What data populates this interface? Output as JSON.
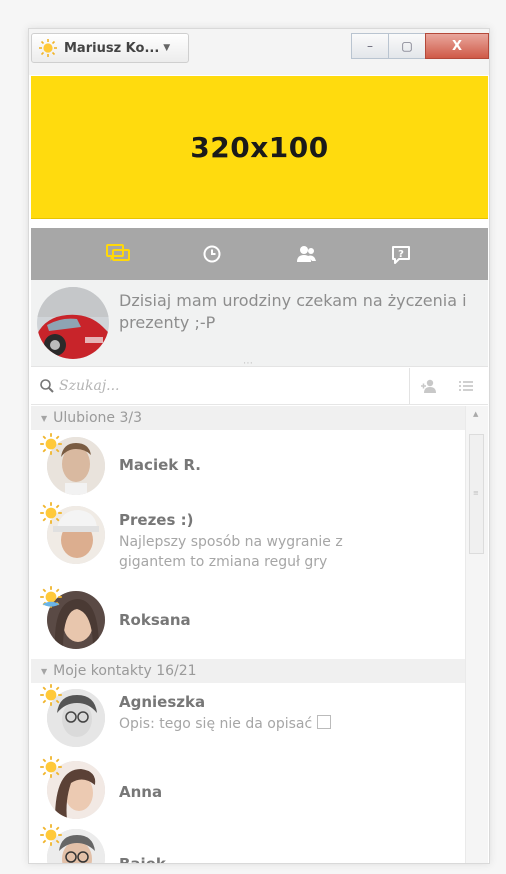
{
  "titlebar": {
    "user_label": "Mariusz Ko...",
    "status_icon": "sun-icon",
    "minimize_label": "–",
    "maximize_label": "▢",
    "close_label": "X"
  },
  "ad": {
    "label": "320x100",
    "background": "#ffdb0e"
  },
  "tabs": [
    {
      "icon": "chat-icon",
      "active": true
    },
    {
      "icon": "clock-icon",
      "active": false
    },
    {
      "icon": "contacts-icon",
      "active": false
    },
    {
      "icon": "help-icon",
      "active": false
    }
  ],
  "profile": {
    "description": "Dzisiaj mam urodziny czekam na życzenia i prezenty ;-P"
  },
  "search": {
    "placeholder": "Szukaj..."
  },
  "groups": [
    {
      "title": "Ulubione 3/3",
      "contacts": [
        {
          "name": "Maciek R.",
          "status": ""
        },
        {
          "name": "Prezes :)",
          "status": "Najlepszy sposób na wygranie z gigantem to zmiana reguł gry"
        },
        {
          "name": "Roksana",
          "status": ""
        }
      ]
    },
    {
      "title": "Moje kontakty 16/21",
      "contacts": [
        {
          "name": "Agnieszka",
          "status": "Opis: tego się nie da opisać"
        },
        {
          "name": "Anna",
          "status": ""
        },
        {
          "name": "Bajek",
          "status": ""
        }
      ]
    }
  ],
  "colors": {
    "tab_active": "#ffd80a",
    "tab_icon": "#ffffff",
    "tabbar_bg": "#a7a7a7"
  }
}
